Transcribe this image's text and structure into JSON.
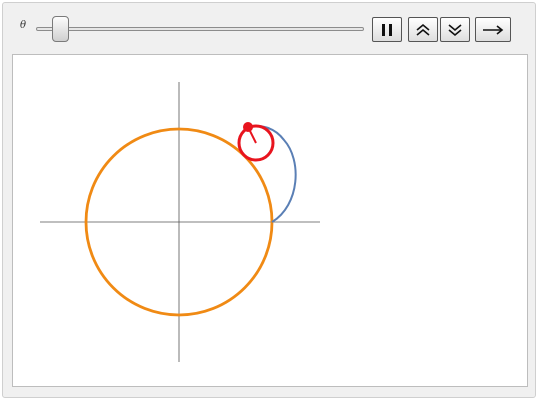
{
  "controls": {
    "slider_label": "θ",
    "slider_value_fraction": 0.05,
    "pause_icon": "pause-icon",
    "faster_icon": "double-chevron-up-icon",
    "slower_icon": "double-chevron-down-icon",
    "direction_icon": "right-arrow-icon"
  },
  "plot": {
    "fixed_circle_color": "#f08a14",
    "rolling_circle_color": "#e8141e",
    "curve_color": "#5a7fb5",
    "axes_color": "#555555"
  }
}
